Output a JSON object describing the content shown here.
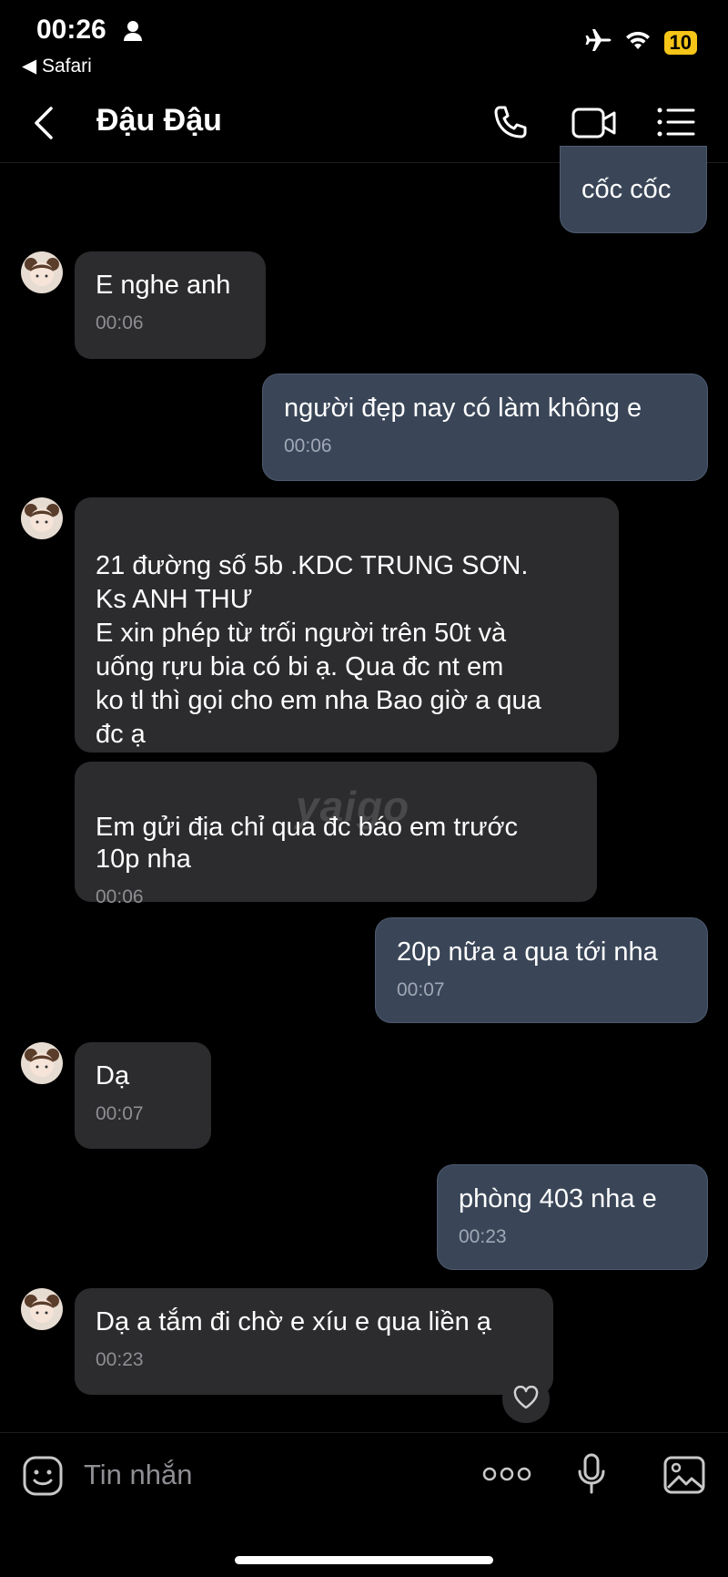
{
  "status_bar": {
    "time": "00:26",
    "back_app": "◀ Safari",
    "battery": "10"
  },
  "header": {
    "title": "Đậu Đậu"
  },
  "messages": [
    {
      "dir": "out",
      "text": "cốc cốc"
    },
    {
      "dir": "in",
      "text": "E nghe anh",
      "time": "00:06"
    },
    {
      "dir": "out",
      "text": "người đẹp nay có làm không e",
      "time": "00:06"
    },
    {
      "dir": "in",
      "text": "21 đường số 5b .KDC TRUNG SƠN.\nKs ANH THƯ\nE xin phép từ trối người trên 50t và\nuống rựu bia  có bi ạ. Qua đc nt em\nko tl thì gọi cho em nha Bao giờ a qua\nđc ạ"
    },
    {
      "dir": "in",
      "text": "Em gửi địa chỉ qua đc báo em trước\n10p nha",
      "time": "00:06"
    },
    {
      "dir": "out",
      "text": "20p nữa a qua tới nha",
      "time": "00:07"
    },
    {
      "dir": "in",
      "text": "Dạ",
      "time": "00:07"
    },
    {
      "dir": "out",
      "text": "phòng 403 nha e",
      "time": "00:23"
    },
    {
      "dir": "in",
      "text": "Dạ a tắm đi chờ e xíu e qua liền ạ",
      "time": "00:23"
    }
  ],
  "watermark": "yaigo",
  "input": {
    "placeholder": "Tin nhắn"
  },
  "colors": {
    "incoming_bubble": "#2c2c2e",
    "outgoing_bubble": "#3a4658",
    "battery": "#f5c518"
  }
}
